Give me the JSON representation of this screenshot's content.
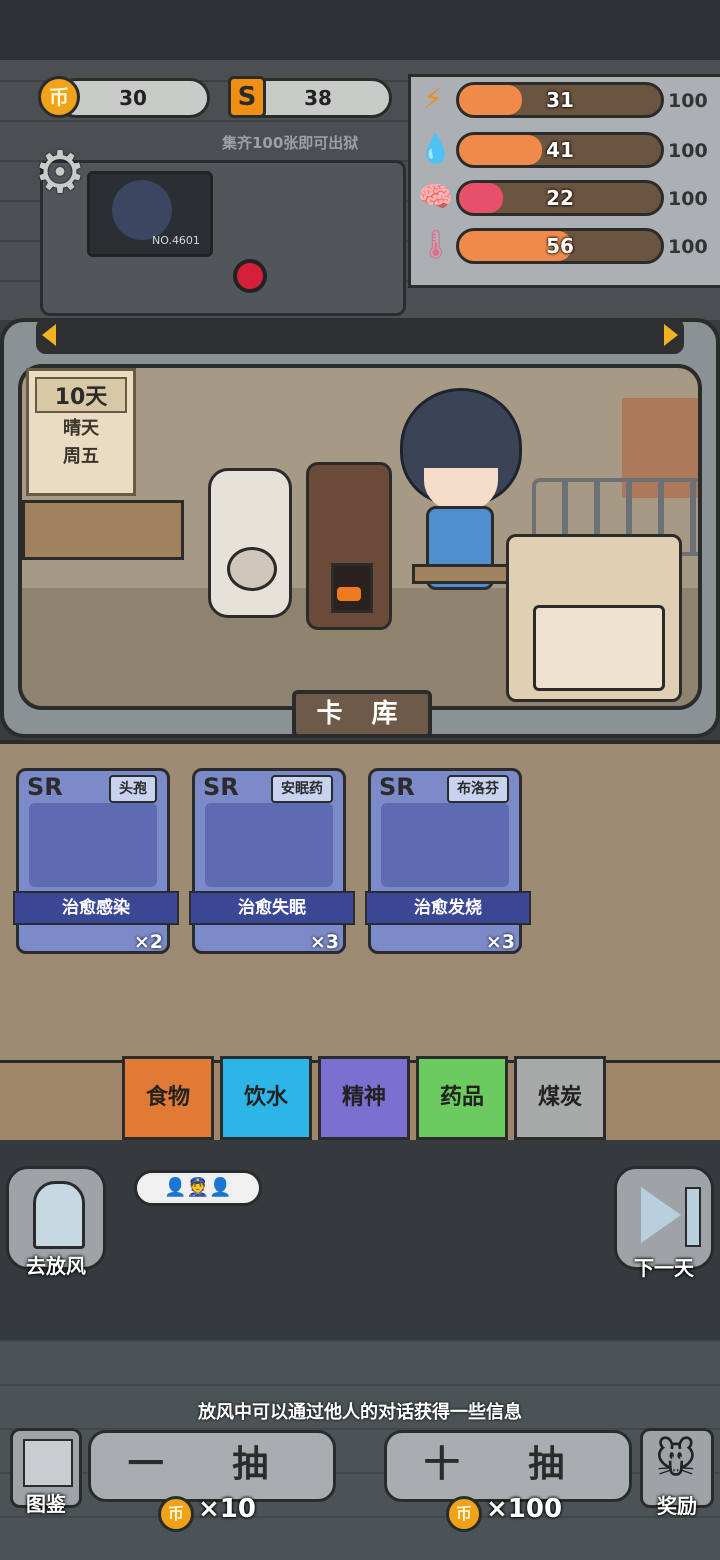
{
  "currency": {
    "coins": "30",
    "shards": "38",
    "coin_icon": "币",
    "shard_icon": "S"
  },
  "escape_note": "集齐100张即可出狱",
  "stats": [
    {
      "name": "energy",
      "icon": "lightning-icon",
      "value": "31",
      "max": "100",
      "fraction": 0.31,
      "color": "#f08a4b"
    },
    {
      "name": "water",
      "icon": "water-drop-icon",
      "value": "41",
      "max": "100",
      "fraction": 0.41,
      "color": "#f08a4b"
    },
    {
      "name": "mind",
      "icon": "brain-icon",
      "value": "22",
      "max": "100",
      "fraction": 0.22,
      "color": "#e8506a"
    },
    {
      "name": "temperature",
      "icon": "thermometer-icon",
      "value": "56",
      "max": "100",
      "fraction": 0.56,
      "color": "#f08a4b"
    }
  ],
  "monitor_label": "NO.4601",
  "calendar": {
    "day": "10天",
    "weather": "晴天",
    "weekday": "周五"
  },
  "card_library_label": "卡 库",
  "cards": [
    {
      "rarity": "SR",
      "name": "头孢",
      "effect": "治愈感染",
      "count": "×2"
    },
    {
      "rarity": "SR",
      "name": "安眠药",
      "effect": "治愈失眠",
      "count": "×3"
    },
    {
      "rarity": "SR",
      "name": "布洛芬",
      "effect": "治愈发烧",
      "count": "×3"
    }
  ],
  "categories": [
    {
      "label": "食物",
      "color": "#e07a35"
    },
    {
      "label": "饮水",
      "color": "#2cb6e8"
    },
    {
      "label": "精神",
      "color": "#7b6fd0"
    },
    {
      "label": "药品",
      "color": "#6ccb5f"
    },
    {
      "label": "煤炭",
      "color": "#a7aaa8"
    }
  ],
  "side_buttons": {
    "go_out": "去放风",
    "next_day": "下一天",
    "gallery": "图鉴",
    "reward": "奖励"
  },
  "hint": "放风中可以通过他人的对话获得一些信息",
  "draw": {
    "one_label": "一 抽",
    "one_cost": "×10",
    "ten_label": "十 抽",
    "ten_cost": "×100"
  }
}
